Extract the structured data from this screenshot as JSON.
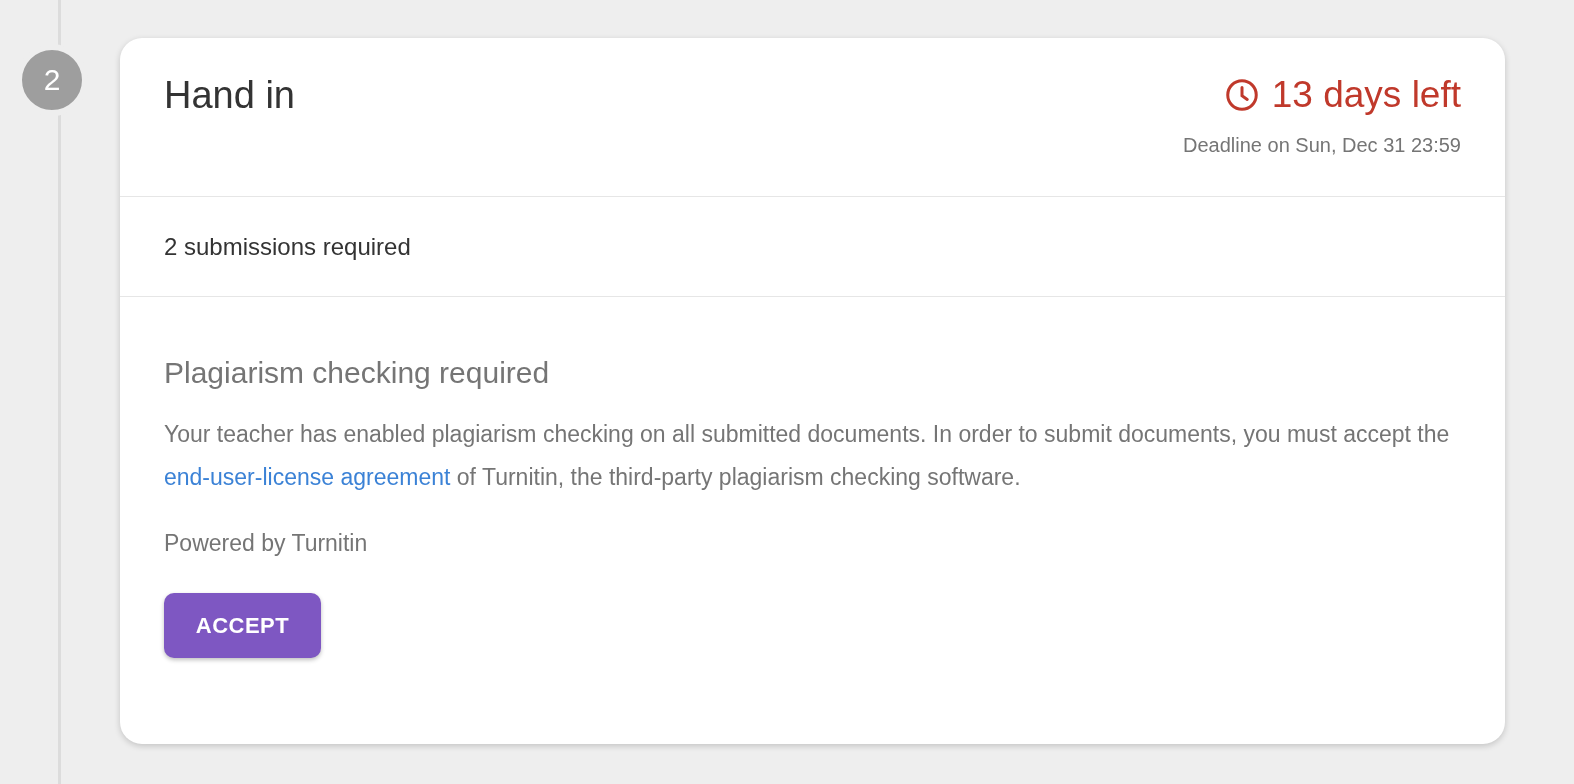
{
  "step": {
    "number": "2"
  },
  "card": {
    "title": "Hand in",
    "countdown": "13 days left",
    "deadline": "Deadline on Sun, Dec 31 23:59",
    "requirement": "2 submissions required",
    "plagiarism": {
      "heading": "Plagiarism checking required",
      "text_before": "Your teacher has enabled plagiarism checking on all submitted documents. In order to submit documents, you must accept the ",
      "link": "end-user-license agreement",
      "text_after": " of Turnitin, the third-party plagiarism checking software.",
      "powered_by": "Powered by Turnitin",
      "button": "ACCEPT"
    }
  }
}
